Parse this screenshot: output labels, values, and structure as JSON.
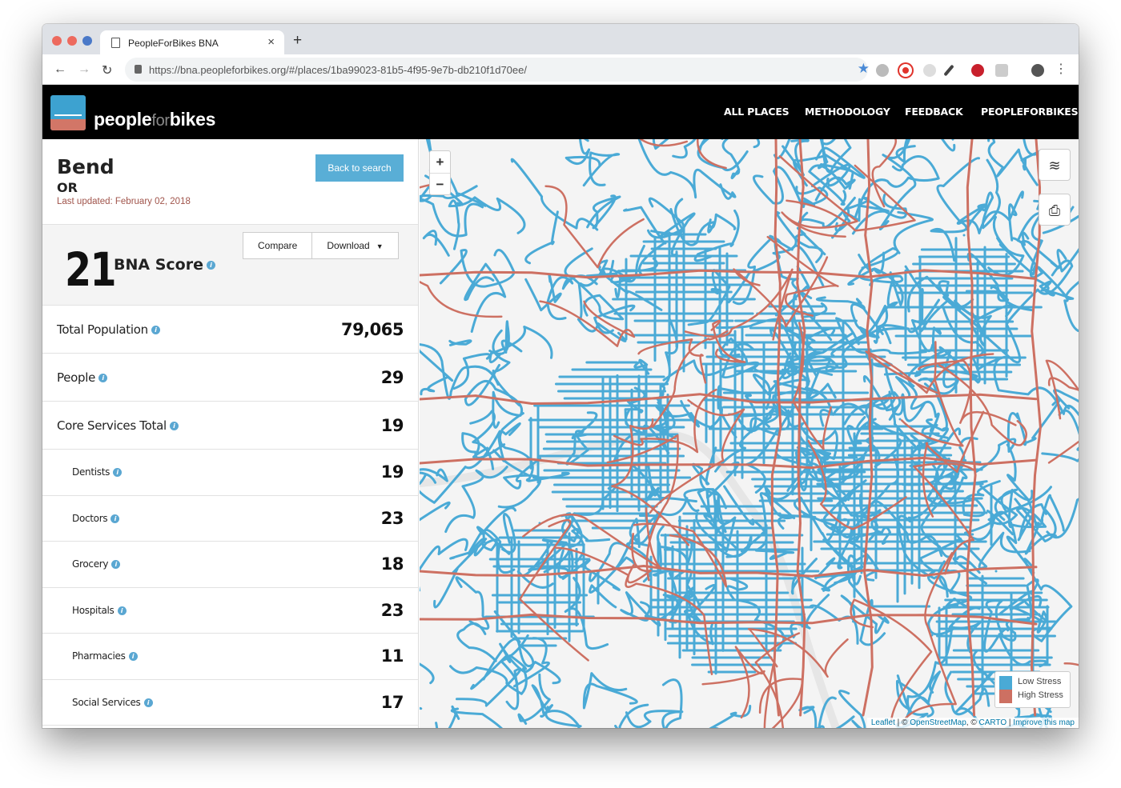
{
  "browser": {
    "tab_title": "PeopleForBikes BNA",
    "url": "https://bna.peopleforbikes.org/#/places/1ba99023-81b5-4f95-9e7b-db210f1d70ee/"
  },
  "site": {
    "logo_text_a": "people",
    "logo_text_b": "for",
    "logo_text_c": "bikes",
    "nav": [
      "ALL PLACES",
      "METHODOLOGY",
      "FEEDBACK",
      "PEOPLEFORBIKES"
    ]
  },
  "place": {
    "name": "Bend",
    "state": "OR",
    "last_updated": "Last updated: February 02, 2018",
    "back_button": "Back to search"
  },
  "score": {
    "value": "21",
    "label": "BNA Score",
    "compare_button": "Compare",
    "download_button": "Download"
  },
  "metrics": [
    {
      "label": "Total Population",
      "value": "79,065",
      "level": "main"
    },
    {
      "label": "People",
      "value": "29",
      "level": "main"
    },
    {
      "label": "Core Services Total",
      "value": "19",
      "level": "main"
    },
    {
      "label": "Dentists",
      "value": "19",
      "level": "sub"
    },
    {
      "label": "Doctors",
      "value": "23",
      "level": "sub"
    },
    {
      "label": "Grocery",
      "value": "18",
      "level": "sub"
    },
    {
      "label": "Hospitals",
      "value": "23",
      "level": "sub"
    },
    {
      "label": "Pharmacies",
      "value": "11",
      "level": "sub"
    },
    {
      "label": "Social Services",
      "value": "17",
      "level": "sub"
    }
  ],
  "map": {
    "zoom_in": "+",
    "zoom_out": "−",
    "legend_low": "Low Stress",
    "legend_high": "High Stress",
    "low_color": "#4aaad6",
    "high_color": "#cd7062",
    "attribution_leaflet": "Leaflet",
    "attribution_sep1": " | © ",
    "attribution_osm": "OpenStreetMap",
    "attribution_sep2": ", © ",
    "attribution_carto": "CARTO",
    "attribution_sep3": " | ",
    "attribution_improve": "Improve this map"
  }
}
